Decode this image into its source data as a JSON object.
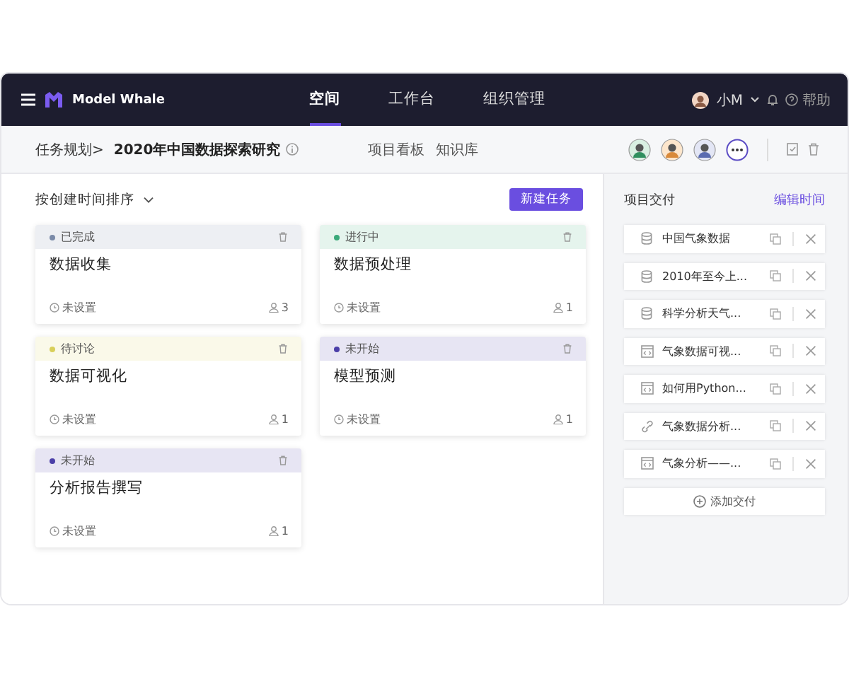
{
  "header": {
    "brand": "Model Whale",
    "nav": [
      {
        "label": "空间",
        "selected": true
      },
      {
        "label": "工作台",
        "selected": false
      },
      {
        "label": "组织管理",
        "selected": false
      }
    ],
    "user": "小M",
    "help": "帮助"
  },
  "subbar": {
    "breadcrumb": "任务规划>",
    "project": "2020年中国数据探索研究",
    "tabs": [
      "项目看板",
      "知识库"
    ]
  },
  "board": {
    "sort": "按创建时间排序",
    "new_button": "新建任务",
    "tasks": [
      {
        "status": "已完成",
        "color": "#7a8aa8",
        "title": "数据收集",
        "due": "未设置",
        "members": "3"
      },
      {
        "status": "进行中",
        "color": "#3aa97a",
        "title": "数据预处理",
        "due": "未设置",
        "members": "1"
      },
      {
        "status": "待讨论",
        "color": "#d8cf5a",
        "title": "数据可视化",
        "due": "未设置",
        "members": "1"
      },
      {
        "status": "未开始",
        "color": "#4b3fa8",
        "title": "模型预测",
        "due": "未设置",
        "members": "1"
      },
      {
        "status": "未开始",
        "color": "#4b3fa8",
        "title": "分析报告撰写",
        "due": "未设置",
        "members": "1"
      }
    ]
  },
  "deliverables": {
    "title": "项目交付",
    "edit": "编辑时间",
    "add": "添加交付",
    "items": [
      {
        "kind": "dataset",
        "name": "中国气象数据"
      },
      {
        "kind": "dataset",
        "name": "2010年至今上..."
      },
      {
        "kind": "dataset",
        "name": "科学分析天气..."
      },
      {
        "kind": "notebook",
        "name": "气象数据可视..."
      },
      {
        "kind": "notebook",
        "name": "如何用Python..."
      },
      {
        "kind": "link",
        "name": "气象数据分析..."
      },
      {
        "kind": "notebook",
        "name": "气象分析——..."
      }
    ]
  }
}
